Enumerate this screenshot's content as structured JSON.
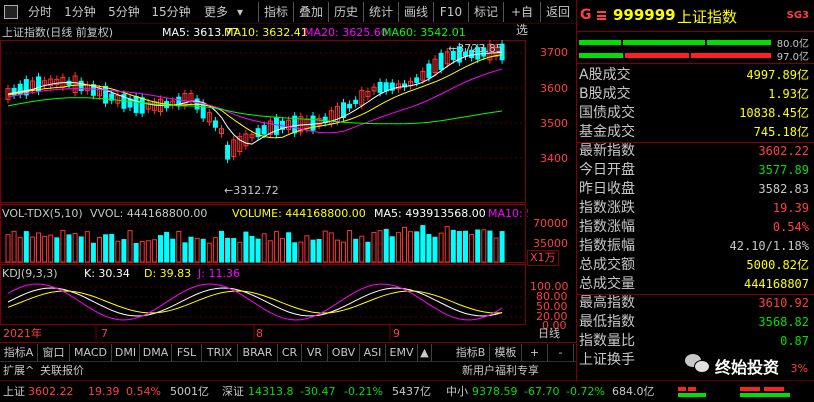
{
  "toolbar": {
    "left_icon": "window-icon",
    "periods": [
      "分时",
      "1分钟",
      "5分钟",
      "15分钟",
      "更多"
    ],
    "tools": [
      "指标",
      "叠加",
      "历史",
      "统计",
      "画线",
      "F10",
      "标记",
      "+自选",
      "返回"
    ]
  },
  "main_legend": {
    "title": "上证指数(日线 前复权)",
    "ma5": "MA5: 3613.77",
    "ma10": "MA10: 3632.41",
    "ma20": "MA20: 3625.60",
    "ma60": "MA60: 3542.01",
    "high_mark": "3723.85",
    "low_mark": "3312.72"
  },
  "price_axis": [
    "3700",
    "3600",
    "3500",
    "3400"
  ],
  "vol_legend": {
    "title": "VOL-TDX(5,10)",
    "vvol": "VVOL: 444168800.00",
    "volume": "VOLUME: 444168800.00",
    "ma5": "MA5: 493913568.00",
    "ma10": "MA10: 5"
  },
  "vol_axis": [
    "70000",
    "35000",
    "X1万"
  ],
  "kdj_legend": {
    "title": "KDJ(9,3,3)",
    "k": "K: 30.34",
    "d": "D: 39.83",
    "j": "J: 11.36"
  },
  "kdj_axis": [
    "100.00",
    "80.00",
    "50.00",
    "20.00",
    "0.00"
  ],
  "date_axis": [
    "2021年",
    "7",
    "8",
    "9"
  ],
  "date_corner": "日线",
  "tabs": [
    "指标A",
    "窗口",
    "MACD",
    "DMI",
    "DMA",
    "FSL",
    "TRIX",
    "BRAR",
    "CR",
    "VR",
    "OBV",
    "ASI",
    "EMV"
  ],
  "tab_right": [
    "指标B",
    "模板",
    "+",
    "-"
  ],
  "mid_left": [
    "扩展^",
    "关联报价"
  ],
  "mid_right": "新用户福利专享",
  "quote_header": {
    "code": "999999",
    "name": "上证指数",
    "badge": "SG3",
    "g_icon": "G",
    "pct_top": "80.0亿",
    "pct_bottom": "97.0亿"
  },
  "quote_rows": [
    {
      "label": "A股成交",
      "value": "4997.89亿",
      "color": "#ffff00"
    },
    {
      "label": "B股成交",
      "value": "1.93亿",
      "color": "#ffff00"
    },
    {
      "label": "国债成交",
      "value": "10838.45亿",
      "color": "#ffff00"
    },
    {
      "label": "基金成交",
      "value": "745.18亿",
      "color": "#ffff00"
    },
    {
      "label": "最新指数",
      "value": "3602.22",
      "color": "#ff4040"
    },
    {
      "label": "今日开盘",
      "value": "3577.89",
      "color": "#00e000"
    },
    {
      "label": "昨日收盘",
      "value": "3582.83",
      "color": "#c8c8c8"
    },
    {
      "label": "指数涨跌",
      "value": "19.39",
      "color": "#ff4040"
    },
    {
      "label": "指数涨幅",
      "value": "0.54%",
      "color": "#ff4040"
    },
    {
      "label": "指数振幅",
      "value": "42.10/1.18%",
      "color": "#c8c8c8"
    },
    {
      "label": "总成交额",
      "value": "5000.82亿",
      "color": "#ffff00"
    },
    {
      "label": "总成交量",
      "value": "444168807",
      "color": "#ffff00"
    },
    {
      "label": "最高指数",
      "value": "3610.92",
      "color": "#ff4040"
    },
    {
      "label": "最低指数",
      "value": "3568.82",
      "color": "#00e000"
    },
    {
      "label": "指数量比",
      "value": "0.87",
      "color": "#00e000"
    },
    {
      "label": "上证换手",
      "value": "",
      "color": "#c8c8c8"
    }
  ],
  "watermark": "终始投资",
  "watermark_pct": "3%",
  "status": [
    {
      "name": "上证",
      "value": "3602.22",
      "chg": "19.39",
      "pct": "0.54%",
      "amt": "5001亿",
      "up": true
    },
    {
      "name": "深证",
      "value": "14313.8",
      "chg": "-30.47",
      "pct": "-0.21%",
      "amt": "5437亿",
      "up": false
    },
    {
      "name": "中小",
      "value": "9378.59",
      "chg": "-67.70",
      "pct": "-0.72%",
      "amt": "684.0亿",
      "up": false
    }
  ],
  "colors": {
    "up": "#ff3333",
    "down": "#00ffff",
    "ma5": "#ffffff",
    "ma10": "#ffff00",
    "ma20": "#ff00ff",
    "ma60": "#00ff00"
  }
}
